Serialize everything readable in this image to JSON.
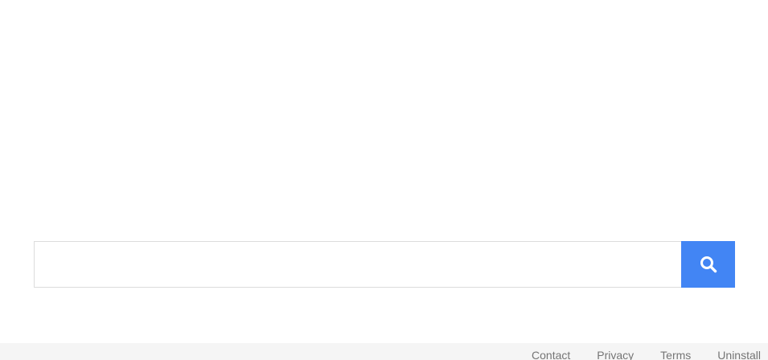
{
  "search": {
    "value": "",
    "placeholder": "",
    "button_icon": "search-icon",
    "button_color": "#4285f4"
  },
  "footer": {
    "links": [
      {
        "label": "Contact"
      },
      {
        "label": "Privacy"
      },
      {
        "label": "Terms"
      },
      {
        "label": "Uninstall"
      }
    ]
  }
}
